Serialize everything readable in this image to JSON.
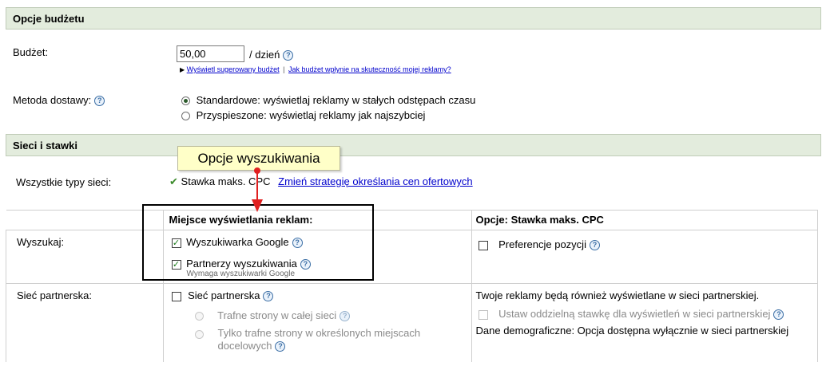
{
  "budget_section": {
    "header": "Opcje budżetu",
    "budget_label": "Budżet:",
    "budget_value": "50,00",
    "per_day": "/ dzień",
    "suggest_link": "Wyświetl sugerowany budżet",
    "separator": "|",
    "effect_link": "Jak budżet wpłynie na skuteczność mojej reklamy?",
    "delivery_label": "Metoda dostawy:",
    "delivery_options": [
      {
        "label": "Standardowe: wyświetlaj reklamy w stałych odstępach czasu",
        "selected": true
      },
      {
        "label": "Przyspieszone: wyświetlaj reklamy jak najszybciej",
        "selected": false
      }
    ]
  },
  "network_section": {
    "header": "Sieci i stawki",
    "all_networks_label": "Wszystkie typy sieci:",
    "bid_type": "Stawka maks. CPC",
    "change_strategy_link": "Zmień strategię określania cen ofertowych",
    "callout": "Opcje wyszukiwania",
    "col_placement": "Miejsce wyświetlania reklam:",
    "col_options": "Opcje: Stawka maks. CPC",
    "search_row": {
      "label": "Wyszukaj:",
      "google": "Wyszukiwarka Google",
      "partners": "Partnerzy wyszukiwania",
      "partners_note": "Wymaga wyszukiwarki Google",
      "position_pref": "Preferencje pozycji"
    },
    "content_row": {
      "label": "Sieć partnerska:",
      "content_network": "Sieć partnerska",
      "relevant_all": "Trafne strony w całej sieci",
      "relevant_selected": "Tylko trafne strony w określonych miejscach docelowych",
      "info": "Twoje reklamy będą również wyświetlane w sieci partnerskiej.",
      "separate_bid": "Ustaw oddzielną stawkę dla wyświetleń w sieci partnerskiej",
      "demographics": "Dane demograficzne: Opcja dostępna wyłącznie w sieci partnerskiej"
    }
  },
  "colors": {
    "header_bg": "#e3ecdd",
    "link": "#0000cc",
    "callout_bg": "#ffffc8",
    "arrow": "#e02020"
  }
}
